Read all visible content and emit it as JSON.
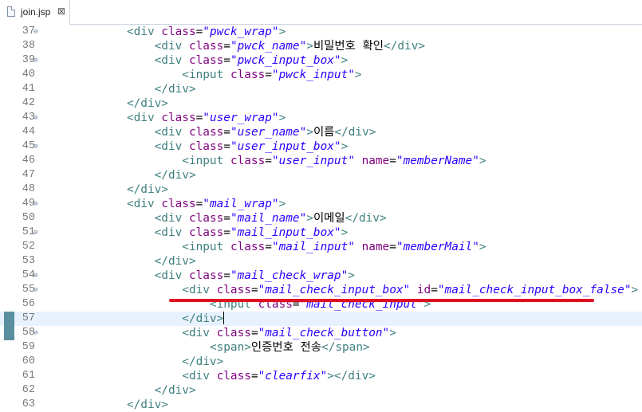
{
  "tab": {
    "filename": "join.jsp",
    "close": "⊠"
  },
  "annotation_color": "#e01020",
  "lines": [
    {
      "n": "37",
      "fold": true,
      "indent": "            ",
      "parts": [
        [
          "tag",
          "<div "
        ],
        [
          "attr",
          "class"
        ],
        [
          "eq",
          "="
        ],
        [
          "val",
          "\"pwck_wrap\""
        ],
        [
          "tag",
          ">"
        ]
      ]
    },
    {
      "n": "38",
      "fold": false,
      "indent": "                ",
      "parts": [
        [
          "tag",
          "<div "
        ],
        [
          "attr",
          "class"
        ],
        [
          "eq",
          "="
        ],
        [
          "val",
          "\"pwck_name\""
        ],
        [
          "tag",
          ">"
        ],
        [
          "txt",
          "비밀번호 확인"
        ],
        [
          "tag",
          "</div>"
        ]
      ]
    },
    {
      "n": "39",
      "fold": true,
      "indent": "                ",
      "parts": [
        [
          "tag",
          "<div "
        ],
        [
          "attr",
          "class"
        ],
        [
          "eq",
          "="
        ],
        [
          "val",
          "\"pwck_input_box\""
        ],
        [
          "tag",
          ">"
        ]
      ]
    },
    {
      "n": "40",
      "fold": false,
      "indent": "                    ",
      "parts": [
        [
          "tag",
          "<input "
        ],
        [
          "attr",
          "class"
        ],
        [
          "eq",
          "="
        ],
        [
          "val",
          "\"pwck_input\""
        ],
        [
          "tag",
          ">"
        ]
      ]
    },
    {
      "n": "41",
      "fold": false,
      "indent": "                ",
      "parts": [
        [
          "tag",
          "</div>"
        ]
      ]
    },
    {
      "n": "42",
      "fold": false,
      "indent": "            ",
      "parts": [
        [
          "tag",
          "</div>"
        ]
      ]
    },
    {
      "n": "43",
      "fold": true,
      "indent": "            ",
      "parts": [
        [
          "tag",
          "<div "
        ],
        [
          "attr",
          "class"
        ],
        [
          "eq",
          "="
        ],
        [
          "val",
          "\"user_wrap\""
        ],
        [
          "tag",
          ">"
        ]
      ]
    },
    {
      "n": "44",
      "fold": false,
      "indent": "                ",
      "parts": [
        [
          "tag",
          "<div "
        ],
        [
          "attr",
          "class"
        ],
        [
          "eq",
          "="
        ],
        [
          "val",
          "\"user_name\""
        ],
        [
          "tag",
          ">"
        ],
        [
          "txt",
          "이름"
        ],
        [
          "tag",
          "</div>"
        ]
      ]
    },
    {
      "n": "45",
      "fold": true,
      "indent": "                ",
      "parts": [
        [
          "tag",
          "<div "
        ],
        [
          "attr",
          "class"
        ],
        [
          "eq",
          "="
        ],
        [
          "val",
          "\"user_input_box\""
        ],
        [
          "tag",
          ">"
        ]
      ]
    },
    {
      "n": "46",
      "fold": false,
      "indent": "                    ",
      "parts": [
        [
          "tag",
          "<input "
        ],
        [
          "attr",
          "class"
        ],
        [
          "eq",
          "="
        ],
        [
          "val",
          "\"user_input\""
        ],
        [
          "attr",
          " name"
        ],
        [
          "eq",
          "="
        ],
        [
          "val",
          "\"memberName\""
        ],
        [
          "tag",
          ">"
        ]
      ]
    },
    {
      "n": "47",
      "fold": false,
      "indent": "                ",
      "parts": [
        [
          "tag",
          "</div>"
        ]
      ]
    },
    {
      "n": "48",
      "fold": false,
      "indent": "            ",
      "parts": [
        [
          "tag",
          "</div>"
        ]
      ]
    },
    {
      "n": "49",
      "fold": true,
      "indent": "            ",
      "parts": [
        [
          "tag",
          "<div "
        ],
        [
          "attr",
          "class"
        ],
        [
          "eq",
          "="
        ],
        [
          "val",
          "\"mail_wrap\""
        ],
        [
          "tag",
          ">"
        ]
      ]
    },
    {
      "n": "50",
      "fold": false,
      "indent": "                ",
      "parts": [
        [
          "tag",
          "<div "
        ],
        [
          "attr",
          "class"
        ],
        [
          "eq",
          "="
        ],
        [
          "val",
          "\"mail_name\""
        ],
        [
          "tag",
          ">"
        ],
        [
          "txt",
          "이메일"
        ],
        [
          "tag",
          "</div>"
        ]
      ]
    },
    {
      "n": "51",
      "fold": true,
      "indent": "                ",
      "parts": [
        [
          "tag",
          "<div "
        ],
        [
          "attr",
          "class"
        ],
        [
          "eq",
          "="
        ],
        [
          "val",
          "\"mail_input_box\""
        ],
        [
          "tag",
          ">"
        ]
      ]
    },
    {
      "n": "52",
      "fold": false,
      "indent": "                    ",
      "parts": [
        [
          "tag",
          "<input "
        ],
        [
          "attr",
          "class"
        ],
        [
          "eq",
          "="
        ],
        [
          "val",
          "\"mail_input\""
        ],
        [
          "attr",
          " name"
        ],
        [
          "eq",
          "="
        ],
        [
          "val",
          "\"memberMail\""
        ],
        [
          "tag",
          ">"
        ]
      ]
    },
    {
      "n": "53",
      "fold": false,
      "indent": "                ",
      "parts": [
        [
          "tag",
          "</div>"
        ]
      ]
    },
    {
      "n": "54",
      "fold": true,
      "indent": "                ",
      "parts": [
        [
          "tag",
          "<div "
        ],
        [
          "attr",
          "class"
        ],
        [
          "eq",
          "="
        ],
        [
          "val",
          "\"mail_check_wrap\""
        ],
        [
          "tag",
          ">"
        ]
      ]
    },
    {
      "n": "55",
      "fold": true,
      "indent": "                    ",
      "parts": [
        [
          "tag",
          "<div "
        ],
        [
          "attr",
          "class"
        ],
        [
          "eq",
          "="
        ],
        [
          "val",
          "\"mail_check_input_box\""
        ],
        [
          "attr",
          " id"
        ],
        [
          "eq",
          "="
        ],
        [
          "val",
          "\"mail_check_input_box_false\""
        ],
        [
          "tag",
          ">"
        ]
      ]
    },
    {
      "n": "56",
      "fold": false,
      "indent": "                        ",
      "parts": [
        [
          "tag",
          "<input "
        ],
        [
          "attr",
          "class"
        ],
        [
          "eq",
          "="
        ],
        [
          "val",
          "\"mail_check_input\""
        ],
        [
          "tag",
          ">"
        ]
      ]
    },
    {
      "n": "57",
      "fold": false,
      "indent": "                    ",
      "current": true,
      "parts": [
        [
          "tag",
          "</div>"
        ]
      ]
    },
    {
      "n": "58",
      "fold": true,
      "indent": "                    ",
      "parts": [
        [
          "tag",
          "<div "
        ],
        [
          "attr",
          "class"
        ],
        [
          "eq",
          "="
        ],
        [
          "val",
          "\"mail_check_button\""
        ],
        [
          "tag",
          ">"
        ]
      ]
    },
    {
      "n": "59",
      "fold": false,
      "indent": "                        ",
      "parts": [
        [
          "tag",
          "<span>"
        ],
        [
          "txt",
          "인증번호 전송"
        ],
        [
          "tag",
          "</span>"
        ]
      ]
    },
    {
      "n": "60",
      "fold": false,
      "indent": "                    ",
      "parts": [
        [
          "tag",
          "</div>"
        ]
      ]
    },
    {
      "n": "61",
      "fold": false,
      "indent": "                    ",
      "parts": [
        [
          "tag",
          "<div "
        ],
        [
          "attr",
          "class"
        ],
        [
          "eq",
          "="
        ],
        [
          "val",
          "\"clearfix\""
        ],
        [
          "tag",
          "></div>"
        ]
      ]
    },
    {
      "n": "62",
      "fold": false,
      "indent": "                ",
      "parts": [
        [
          "tag",
          "</div>"
        ]
      ]
    },
    {
      "n": "63",
      "fold": false,
      "indent": "            ",
      "parts": [
        [
          "tag",
          "</div>"
        ]
      ]
    }
  ]
}
